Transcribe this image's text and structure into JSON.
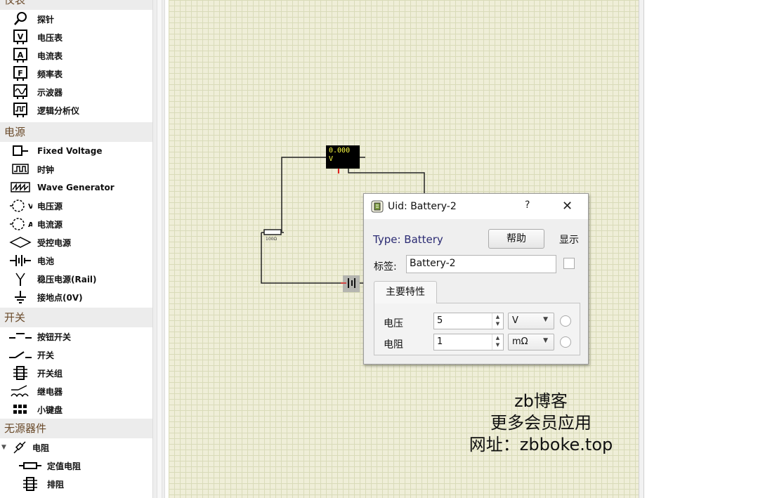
{
  "sidebar": {
    "categories": [
      {
        "title": "仪表",
        "items": [
          {
            "label": "探针",
            "icon": "probe-icon"
          },
          {
            "label": "电压表",
            "icon": "voltmeter-icon"
          },
          {
            "label": "电流表",
            "icon": "ammeter-icon"
          },
          {
            "label": "频率表",
            "icon": "frequency-meter-icon"
          },
          {
            "label": "示波器",
            "icon": "oscilloscope-icon"
          },
          {
            "label": "逻辑分析仪",
            "icon": "logic-analyzer-icon"
          }
        ]
      },
      {
        "title": "电源",
        "items": [
          {
            "label": "Fixed Voltage",
            "icon": "fixed-voltage-icon"
          },
          {
            "label": "时钟",
            "icon": "clock-icon"
          },
          {
            "label": "Wave Generator",
            "icon": "wave-generator-icon"
          },
          {
            "label": "电压源",
            "icon": "voltage-source-icon"
          },
          {
            "label": "电流源",
            "icon": "current-source-icon"
          },
          {
            "label": "受控电源",
            "icon": "controlled-source-icon"
          },
          {
            "label": "电池",
            "icon": "battery-icon"
          },
          {
            "label": "稳压电源(Rail)",
            "icon": "rail-icon"
          },
          {
            "label": "接地点(0V)",
            "icon": "ground-icon"
          }
        ]
      },
      {
        "title": "开关",
        "items": [
          {
            "label": "按钮开关",
            "icon": "push-button-icon"
          },
          {
            "label": "开关",
            "icon": "switch-icon"
          },
          {
            "label": "开关组",
            "icon": "dip-switch-icon"
          },
          {
            "label": "继电器",
            "icon": "relay-icon"
          },
          {
            "label": "小键盘",
            "icon": "keypad-icon"
          }
        ]
      },
      {
        "title": "无源器件",
        "items": [
          {
            "label": "电阻",
            "icon": "resistor-category-icon",
            "tree": true
          },
          {
            "label": "定值电阻",
            "icon": "fixed-resistor-icon",
            "sub": true
          },
          {
            "label": "排阻",
            "icon": "resistor-pack-icon",
            "sub": true
          }
        ]
      }
    ]
  },
  "canvas": {
    "meter_value": "0.000",
    "meter_unit": "V",
    "resistor_label": "100Ω"
  },
  "dialog": {
    "title": "Uid: Battery-2",
    "help_symbol": "?",
    "close_symbol": "✕",
    "type_text": "Type: Battery",
    "help_button": "帮助",
    "show_label": "显示",
    "tag_label": "标签:",
    "tag_value": "Battery-2",
    "tab_label": "主要特性",
    "properties": [
      {
        "label": "电压",
        "value": "5",
        "unit": "V"
      },
      {
        "label": "电阻",
        "value": "1",
        "unit": "mΩ"
      }
    ]
  },
  "watermark": {
    "line1": "zb博客",
    "line2": "更多会员应用",
    "line3": "网址：zbboke.top"
  }
}
